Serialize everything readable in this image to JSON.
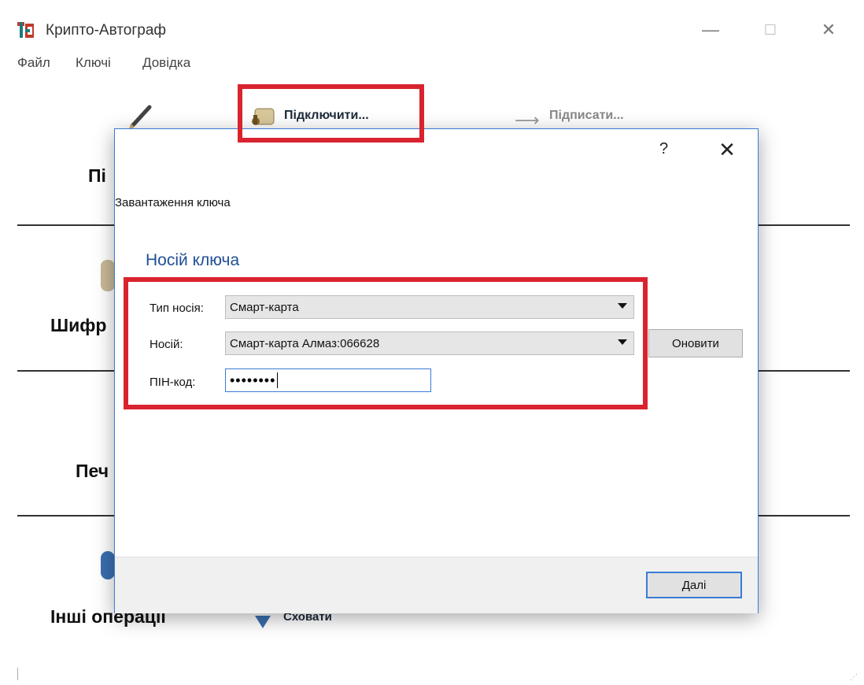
{
  "window": {
    "title": "Крипто-Автограф",
    "minimize": "—",
    "maximize": "☐",
    "close": "✕"
  },
  "menu": [
    "Файл",
    "Ключі",
    "Довідка"
  ],
  "toolbar": {
    "connect_label": "Підключити...",
    "sign_label": "Підписати..."
  },
  "sections": [
    {
      "label": "Пі"
    },
    {
      "label": "Шифр"
    },
    {
      "label": "Печ"
    },
    {
      "label": "Інші операції"
    }
  ],
  "hide_label": "Сховати",
  "dialog": {
    "help": "?",
    "close": "✕",
    "title": "Завантаження ключа",
    "heading": "Носій ключа",
    "media_type_label": "Тип носія:",
    "media_type_value": "Смарт-карта",
    "media_label": "Носій:",
    "media_value": "Смарт-карта Алмаз:066628",
    "refresh_button": "Оновити",
    "pin_label": "ПІН-код:",
    "pin_value": "••••••••",
    "next_button": "Далі"
  },
  "colors": {
    "highlight": "#d9232e",
    "heading": "#1f4f96",
    "accent": "#3a7bd5"
  }
}
